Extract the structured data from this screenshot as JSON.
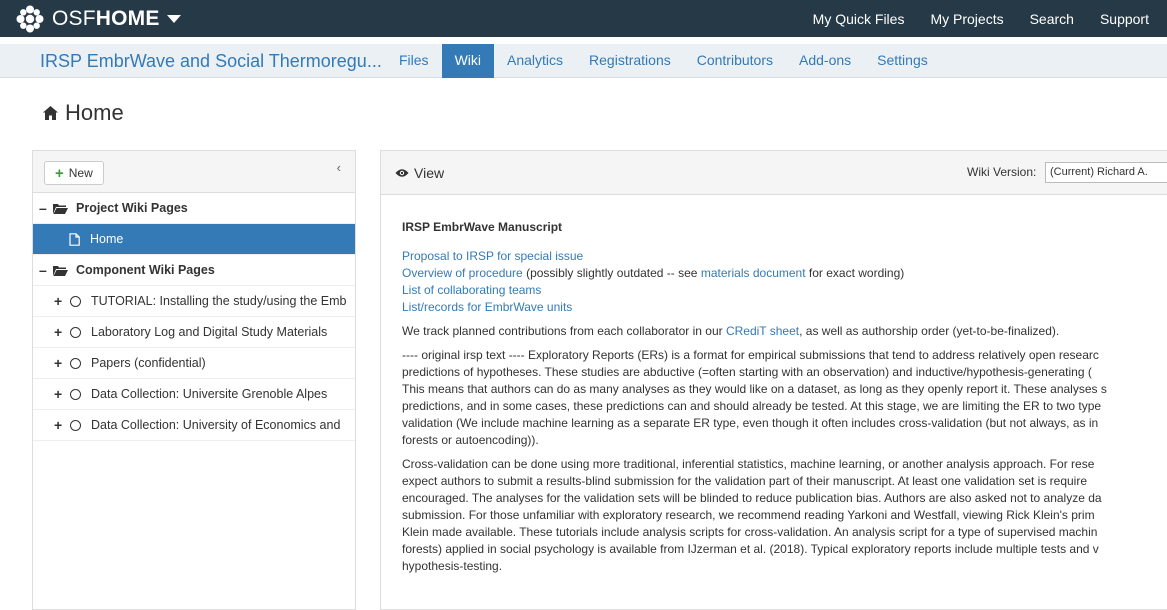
{
  "brand": {
    "prefix": "OSF",
    "suffix": "HOME"
  },
  "topnav": [
    "My Quick Files",
    "My Projects",
    "Search",
    "Support"
  ],
  "project": {
    "title": "IRSP EmbrWave and Social Thermoregu...",
    "tabs": [
      "Files",
      "Wiki",
      "Analytics",
      "Registrations",
      "Contributors",
      "Add-ons",
      "Settings"
    ],
    "active_tab": "Wiki"
  },
  "page_title": "Home",
  "sidebar": {
    "new_label": "New",
    "collapse_glyph": "‹",
    "project_group": "Project Wiki Pages",
    "selected_page": "Home",
    "component_group": "Component Wiki Pages",
    "components": [
      "TUTORIAL: Installing the study/using the Emb",
      "Laboratory Log and Digital Study Materials",
      "Papers (confidential)",
      "Data Collection: Universite Grenoble Alpes",
      "Data Collection: University of Economics and"
    ]
  },
  "main": {
    "view_label": "View",
    "version_label": "Wiki Version:",
    "version_value": "(Current) Richard A.",
    "heading": "IRSP EmbrWave Manuscript",
    "link1": "Proposal to IRSP for special issue",
    "link2": "Overview of procedure",
    "link2_after": " (possibly slightly outdated -- see ",
    "link2_doc": "materials document",
    "link2_end": " for exact wording)",
    "link3": "List of collaborating teams",
    "link4": "List/records for EmbrWave units",
    "track_before": "We track planned contributions from each collaborator in our ",
    "track_link": "CRediT sheet",
    "track_after": ", as well as authorship order (yet-to-be-finalized).",
    "para1": [
      "---- original irsp text ---- Exploratory Reports (ERs) is a format for empirical submissions that tend to address relatively open researc",
      "predictions of hypotheses. These studies are abductive (=often starting with an observation) and inductive/hypothesis-generating (",
      "This means that authors can do as many analyses as they would like on a dataset, as long as they openly report it. These analyses s",
      "predictions, and in some cases, these predictions can and should already be tested. At this stage, we are limiting the ER to two type",
      "validation (We include machine learning as a separate ER type, even though it often includes cross-validation (but not always, as in",
      "forests or autoencoding))."
    ],
    "para2": [
      "Cross-validation can be done using more traditional, inferential statistics, machine learning, or another analysis approach. For rese",
      "expect authors to submit a results-blind submission for the validation part of their manuscript. At least one validation set is require",
      "encouraged. The analyses for the validation sets will be blinded to reduce publication bias. Authors are also asked not to analyze da",
      "submission. For those unfamiliar with exploratory research, we recommend reading Yarkoni and Westfall, viewing Rick Klein's prim",
      "Klein made available. These tutorials include analysis scripts for cross-validation. An analysis script for a type of supervised machin",
      "forests) applied in social psychology is available from IJzerman et al. (2018). Typical exploratory reports include multiple tests and v",
      "hypothesis-testing."
    ]
  }
}
